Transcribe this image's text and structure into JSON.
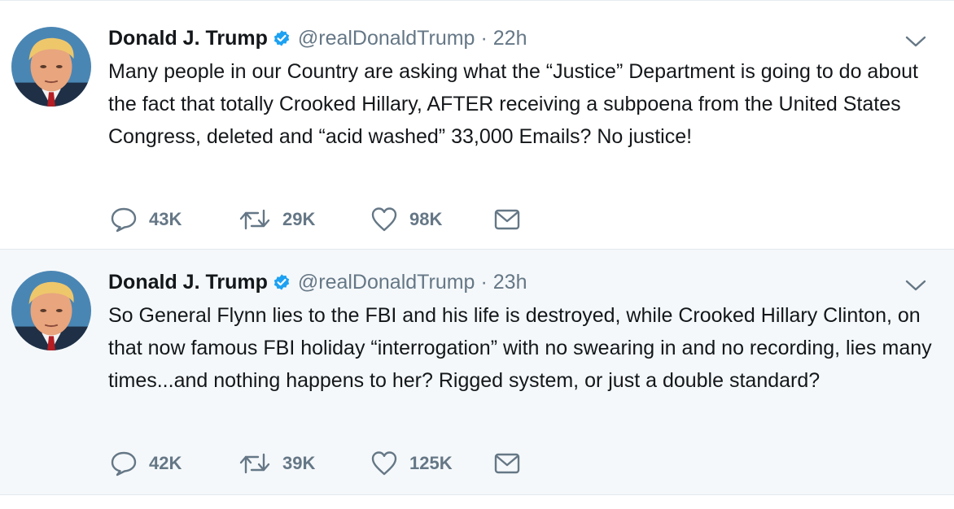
{
  "colors": {
    "text": "#14171a",
    "secondary": "#657786",
    "verified": "#1da1f2",
    "border": "#e1e8ed",
    "highlight_bg": "#f5f8fa"
  },
  "tweets": [
    {
      "author_name": "Donald J. Trump",
      "verified_icon": "verified-badge-icon",
      "handle": "@realDonaldTrump",
      "separator": "·",
      "time": "22h",
      "text": "Many people in our Country are asking what the “Justice” Department is going to do about the fact that totally Crooked Hillary, AFTER receiving a subpoena from the United States Congress, deleted and “acid washed” 33,000 Emails? No justice!",
      "replies": "43K",
      "retweets": "29K",
      "likes": "98K"
    },
    {
      "author_name": "Donald J. Trump",
      "verified_icon": "verified-badge-icon",
      "handle": "@realDonaldTrump",
      "separator": "·",
      "time": "23h",
      "text": "So General Flynn lies to the FBI and his life is destroyed, while Crooked Hillary Clinton, on that now famous FBI holiday “interrogation” with no swearing in and no recording, lies many times...and nothing happens to her? Rigged system, or just a double standard?",
      "replies": "42K",
      "retweets": "39K",
      "likes": "125K"
    }
  ]
}
